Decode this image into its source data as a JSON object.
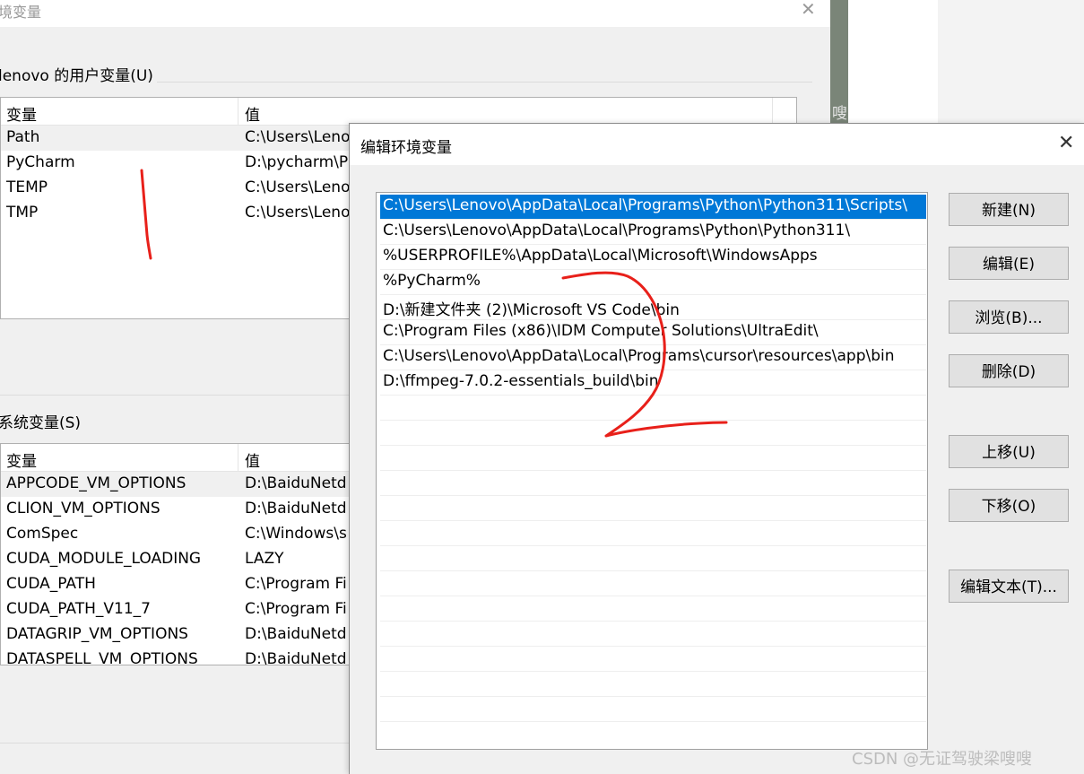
{
  "parent_window": {
    "title": "境变量",
    "close_glyph": "✕",
    "user_group_label": "lenovo 的用户变量(U)",
    "system_group_label": "系统变量(S)",
    "columns": [
      "变量",
      "值"
    ],
    "user_vars": [
      {
        "name": "Path",
        "value": "C:\\Users\\Leno"
      },
      {
        "name": "PyCharm",
        "value": "D:\\pycharm\\P"
      },
      {
        "name": "TEMP",
        "value": "C:\\Users\\Leno"
      },
      {
        "name": "TMP",
        "value": "C:\\Users\\Leno"
      }
    ],
    "system_vars": [
      {
        "name": "APPCODE_VM_OPTIONS",
        "value": "D:\\BaiduNetd"
      },
      {
        "name": "CLION_VM_OPTIONS",
        "value": "D:\\BaiduNetd"
      },
      {
        "name": "ComSpec",
        "value": "C:\\Windows\\s"
      },
      {
        "name": "CUDA_MODULE_LOADING",
        "value": "LAZY"
      },
      {
        "name": "CUDA_PATH",
        "value": "C:\\Program Fi"
      },
      {
        "name": "CUDA_PATH_V11_7",
        "value": "C:\\Program Fi"
      },
      {
        "name": "DATAGRIP_VM_OPTIONS",
        "value": "D:\\BaiduNetd"
      },
      {
        "name": "DATASPELL_VM_OPTIONS",
        "value": "D:\\BaiduNetd"
      }
    ]
  },
  "background": {
    "side_text": "嗖"
  },
  "dialog": {
    "title": "编辑环境变量",
    "close_glyph": "✕",
    "entries": [
      "C:\\Users\\Lenovo\\AppData\\Local\\Programs\\Python\\Python311\\Scripts\\",
      "C:\\Users\\Lenovo\\AppData\\Local\\Programs\\Python\\Python311\\",
      "%USERPROFILE%\\AppData\\Local\\Microsoft\\WindowsApps",
      "%PyCharm%",
      "D:\\新建文件夹 (2)\\Microsoft VS Code\\bin",
      "C:\\Program Files (x86)\\IDM Computer Solutions\\UltraEdit\\",
      "C:\\Users\\Lenovo\\AppData\\Local\\Programs\\cursor\\resources\\app\\bin",
      "D:\\ffmpeg-7.0.2-essentials_build\\bin"
    ],
    "buttons": {
      "new": "新建(N)",
      "edit": "编辑(E)",
      "browse": "浏览(B)...",
      "delete": "删除(D)",
      "move_up": "上移(U)",
      "move_down": "下移(O)",
      "edit_text": "编辑文本(T)..."
    }
  },
  "watermark": "CSDN @无证驾驶梁嗖嗖",
  "colors": {
    "selection": "#0078d7",
    "annotation": "#e8201a"
  }
}
